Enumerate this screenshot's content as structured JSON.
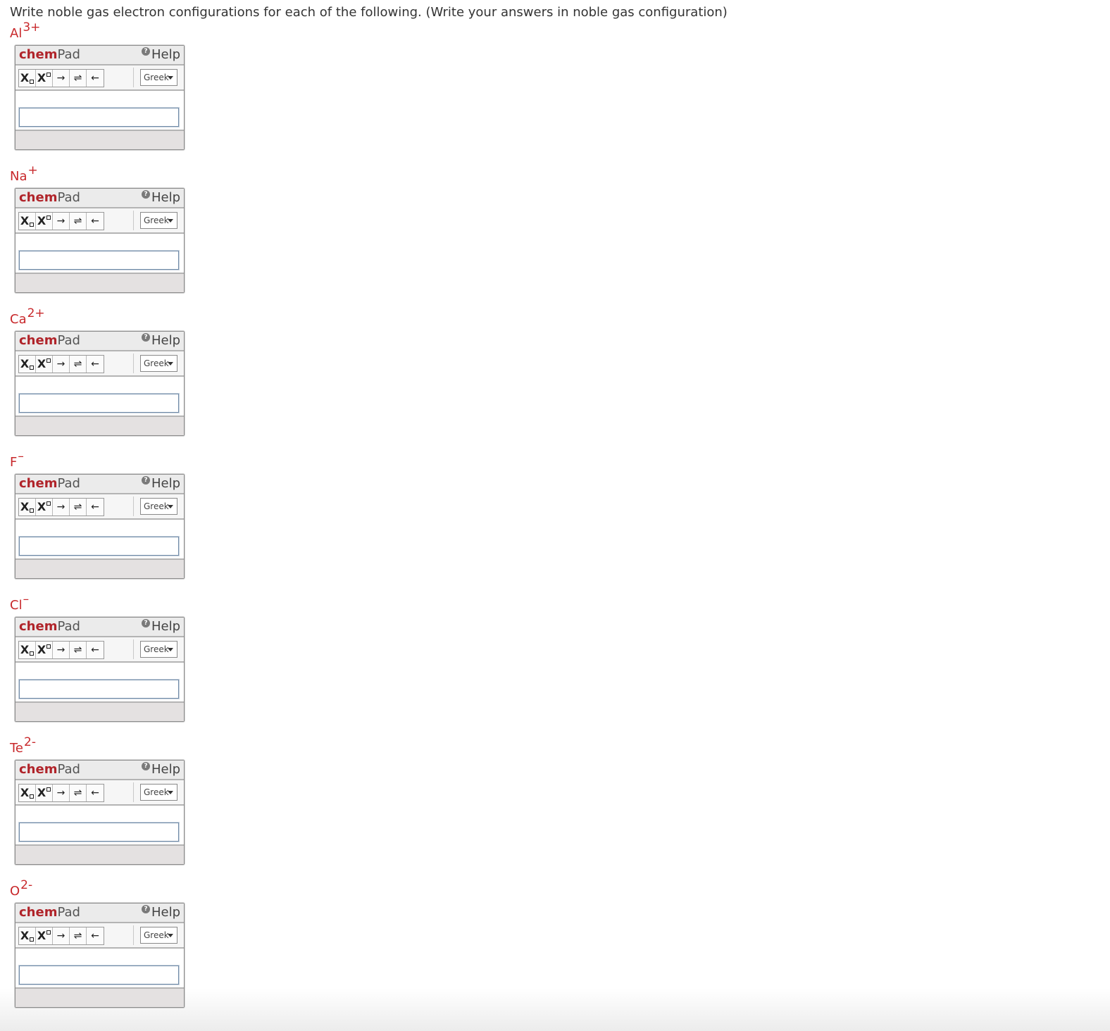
{
  "instruction": "Write noble gas electron configurations for each of the following. (Write your answers in noble gas configuration)",
  "widget": {
    "title_bold": "chem",
    "title_rest": "Pad",
    "help_label": "Help",
    "toolbar": {
      "subscript_label": "X",
      "superscript_label": "X",
      "right_arrow": "→",
      "equilibrium_arrow": "⇌",
      "left_arrow": "←",
      "greek_label": "Greek"
    },
    "input_value": ""
  },
  "questions": [
    {
      "symbol": "Al",
      "charge": "3+"
    },
    {
      "symbol": "Na",
      "charge": "+"
    },
    {
      "symbol": "Ca",
      "charge": "2+"
    },
    {
      "symbol": "F",
      "charge": "–"
    },
    {
      "symbol": "Cl",
      "charge": "–"
    },
    {
      "symbol": "Te",
      "charge": "2-"
    },
    {
      "symbol": "O",
      "charge": "2-"
    }
  ],
  "colors": {
    "ion_label": "#c8282b",
    "brand_red": "#b0242a",
    "instruction_text": "#333333"
  }
}
